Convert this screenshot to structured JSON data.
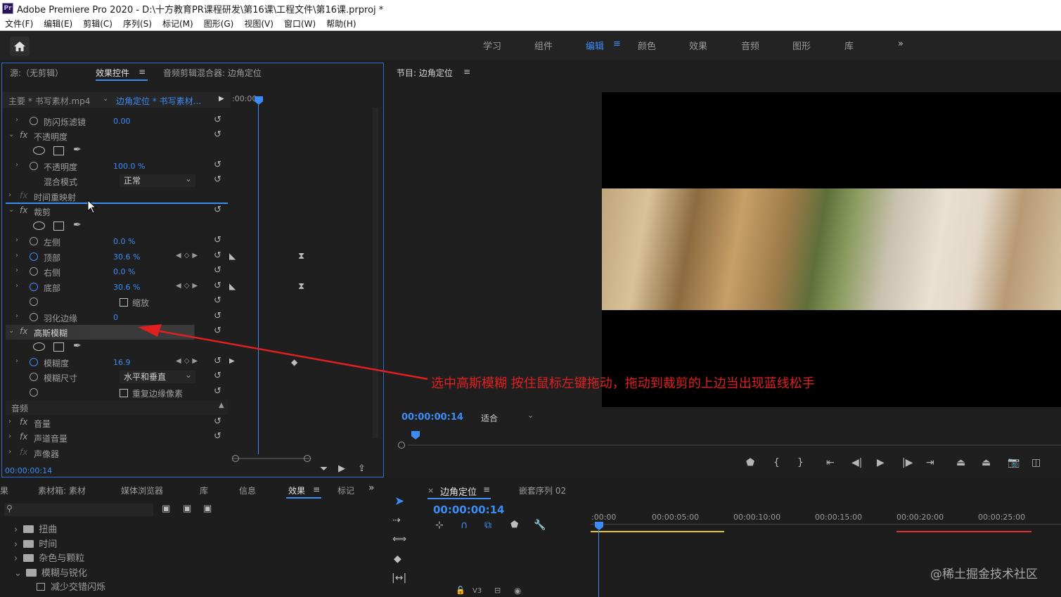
{
  "titlebar": {
    "logo": "Pr",
    "title": "Adobe Premiere Pro 2020 - D:\\十方教育PR课程研发\\第16课\\工程文件\\第16课.prproj *"
  },
  "menu": [
    "文件(F)",
    "编辑(E)",
    "剪辑(C)",
    "序列(S)",
    "标记(M)",
    "图形(G)",
    "视图(V)",
    "窗口(W)",
    "帮助(H)"
  ],
  "workspaces": [
    {
      "label": "学习"
    },
    {
      "label": "组件"
    },
    {
      "label": "编辑",
      "active": true
    },
    {
      "label": "颜色"
    },
    {
      "label": "效果"
    },
    {
      "label": "音频"
    },
    {
      "label": "图形"
    },
    {
      "label": "库"
    }
  ],
  "workspace_more": "»",
  "source": {
    "tab_source": "源:（无剪辑）",
    "tab_effect_controls": "效果控件",
    "tab_audio_mixer": "音频剪辑混合器: 边角定位",
    "clip_master": "主要 * 书写素材.mp4",
    "clip_sequence": "边角定位 * 书写素材...",
    "timecode_ruler": ":00:00",
    "rows": {
      "antiflicker_label": "防闪烁滤镜",
      "antiflicker_value": "0.00",
      "opacity_group": "不透明度",
      "opacity_label": "不透明度",
      "opacity_value": "100.0 %",
      "blend_label": "混合模式",
      "blend_value": "正常",
      "time_remap": "时间重映射",
      "crop_group": "裁剪",
      "left_label": "左侧",
      "left_value": "0.0 %",
      "top_label": "顶部",
      "top_value": "30.6 %",
      "right_label": "右侧",
      "right_value": "0.0 %",
      "bottom_label": "底部",
      "bottom_value": "30.6 %",
      "zoom_label": "缩放",
      "feather_label": "羽化边缘",
      "feather_value": "0",
      "gauss_group": "高斯模糊",
      "blurriness_label": "模糊度",
      "blurriness_value": "16.9",
      "blur_dim_label": "模糊尺寸",
      "blur_dim_value": "水平和垂直",
      "repeat_edge_label": "重复边缘像素",
      "audio_section": "音频",
      "volume_label": "音量",
      "channel_volume_label": "声道音量",
      "panner_label": "声像器"
    },
    "footer_timecode": "00:00:00:14"
  },
  "program": {
    "title": "节目: 边角定位",
    "timecode": "00:00:00:14",
    "fit": "适合"
  },
  "project": {
    "tabs": [
      "果",
      "素材箱: 素材",
      "媒体浏览器",
      "库",
      "信息",
      "效果",
      "标记"
    ],
    "active_tab": "效果",
    "tree": [
      "扭曲",
      "时间",
      "杂色与颗粒",
      "模糊与锐化",
      "减少交错闪烁"
    ]
  },
  "timeline": {
    "tab_active": "边角定位",
    "tab_other": "嵌套序列 02",
    "timecode": "00:00:00:14",
    "ruler": [
      ":00:00",
      "00:00:05:00",
      "00:00:10:00",
      "00:00:15:00",
      "00:00:20:00",
      "00:00:25:00"
    ],
    "track": "V3"
  },
  "annotation": "选中高斯模糊 按住鼠标左键拖动，拖动到裁剪的上边当出现蓝线松手",
  "watermark": "@稀土掘金技术社区",
  "colors": {
    "accent": "#3c8cf5",
    "annotation": "#e02020",
    "timecode": "#3c8cf5"
  }
}
